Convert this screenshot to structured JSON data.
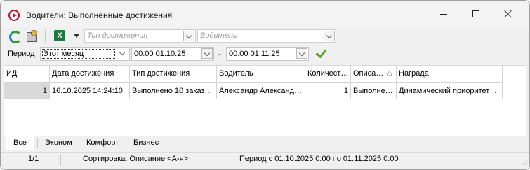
{
  "window": {
    "title": "Водители: Выполненные достижения"
  },
  "toolbar": {
    "achievement_type_placeholder": "Тип достижения",
    "driver_placeholder": "Водитель"
  },
  "period": {
    "label": "Период",
    "preset": "Этот месяц",
    "from": "00:00 01.10.25",
    "separator": "-",
    "to": "00:00 01.11.25"
  },
  "grid": {
    "columns": [
      "ИД",
      "Дата достижения",
      "Тип достижения",
      "Водитель",
      "Количест…",
      "Описа…",
      "Награда"
    ],
    "sort_indicator": "△",
    "rows": [
      [
        "1",
        "16.10.2025 14:24:10",
        "Выполнено 10 заказо…",
        "Александр Александ…",
        "1",
        "Выполне…",
        "Динамический приоритет …"
      ]
    ]
  },
  "tabs": [
    "Все",
    "Эконом",
    "Комфорт",
    "Бизнес"
  ],
  "status": {
    "records": "1/1",
    "sort": "Сортировка: Описание <А-я>",
    "period": "Период с 01.10.2025 0:00 по 01.11.2025 0:00"
  },
  "colors": {
    "accent_green": "#5aa02c",
    "app_icon_red": "#c0102a",
    "excel_green": "#1e7a3c"
  }
}
